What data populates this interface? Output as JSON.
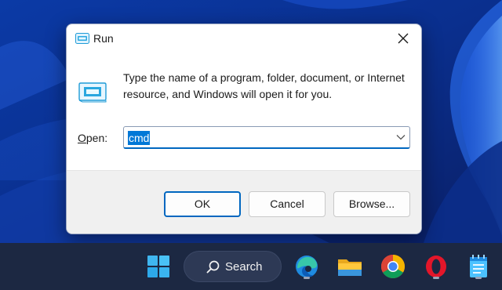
{
  "dialog": {
    "title": "Run",
    "close_glyph": "×",
    "description": "Type the name of a program, folder, document, or Internet resource, and Windows will open it for you.",
    "open_label_access_key": "O",
    "open_label_rest": "pen:",
    "open_value": "cmd",
    "buttons": {
      "ok": "OK",
      "cancel": "Cancel",
      "browse": "Browse..."
    }
  },
  "taskbar": {
    "search_label": "Search",
    "apps": [
      {
        "name": "windows-start",
        "icon": "windows-logo-icon"
      },
      {
        "name": "edge",
        "icon": "edge-icon",
        "running": true
      },
      {
        "name": "file-explorer",
        "icon": "folder-icon"
      },
      {
        "name": "chrome",
        "icon": "chrome-icon"
      },
      {
        "name": "opera",
        "icon": "opera-icon",
        "running": true
      },
      {
        "name": "notepad",
        "icon": "notepad-icon",
        "running": true
      }
    ]
  },
  "colors": {
    "accent": "#0067c0",
    "selection": "#0078d7",
    "taskbar": "#1c2842",
    "dialog_footer": "#f0f0f0"
  }
}
